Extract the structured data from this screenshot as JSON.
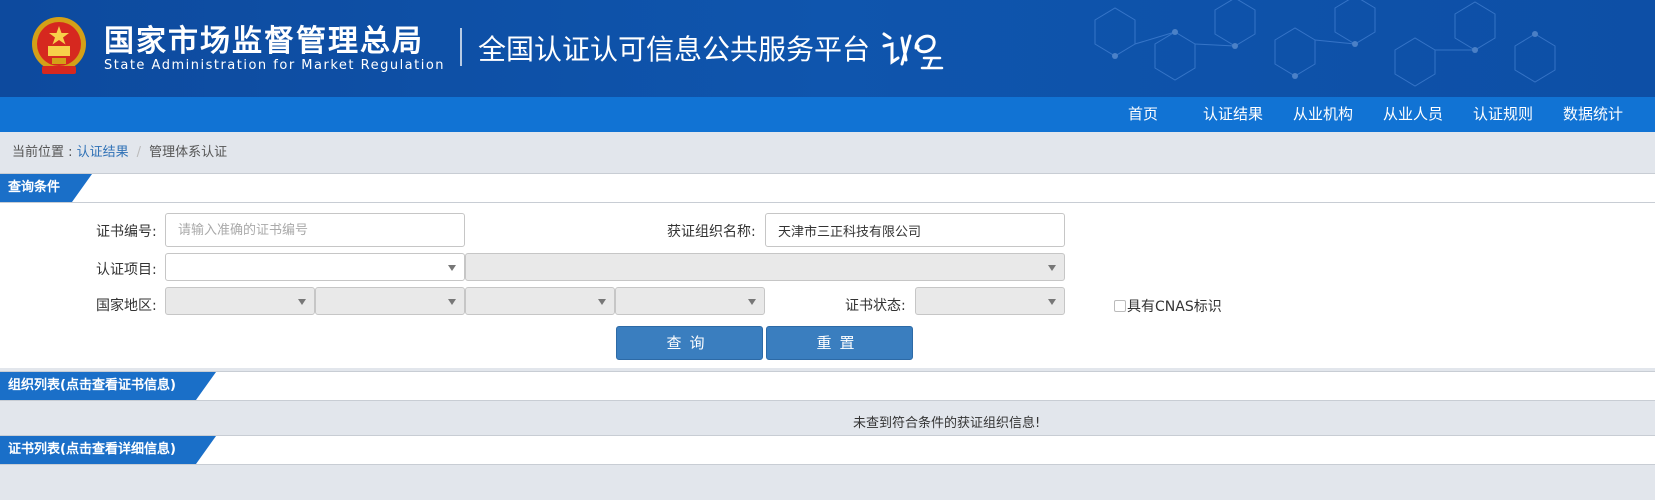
{
  "header": {
    "agency_cn": "国家市场监督管理总局",
    "agency_en": "State Administration  for  Market Regulation",
    "platform_name": "全国认证认可信息公共服务平台",
    "logo_text": "认e云"
  },
  "nav": {
    "items": [
      {
        "label": "首页"
      },
      {
        "label": "认证结果"
      },
      {
        "label": "从业机构"
      },
      {
        "label": "从业人员"
      },
      {
        "label": "认证规则"
      },
      {
        "label": "数据统计"
      }
    ]
  },
  "breadcrumb": {
    "prefix": "当前位置 : ",
    "level1": "认证结果",
    "separator": "/",
    "level2": "管理体系认证"
  },
  "query_section": {
    "title": "查询条件",
    "cert_no_label": "证书编号:",
    "cert_no_placeholder": "请输入准确的证书编号",
    "cert_no_value": "",
    "org_name_label": "获证组织名称:",
    "org_name_value": "天津市三正科技有限公司",
    "project_label": "认证项目:",
    "region_label": "国家地区:",
    "status_label": "证书状态:",
    "cnas_label": "具有CNAS标识",
    "query_button": "查询",
    "reset_button": "重置"
  },
  "org_list_section": {
    "title": "组织列表(点击查看证书信息)",
    "empty_message": "未查到符合条件的获证组织信息!"
  },
  "cert_list_section": {
    "title": "证书列表(点击查看详细信息)"
  },
  "colors": {
    "header_bg": "#0f55ad",
    "nav_bg": "#1173d4",
    "section_tab_bg": "#1a6fc8",
    "button_bg": "#3a7ebf",
    "link": "#2f71b6"
  }
}
